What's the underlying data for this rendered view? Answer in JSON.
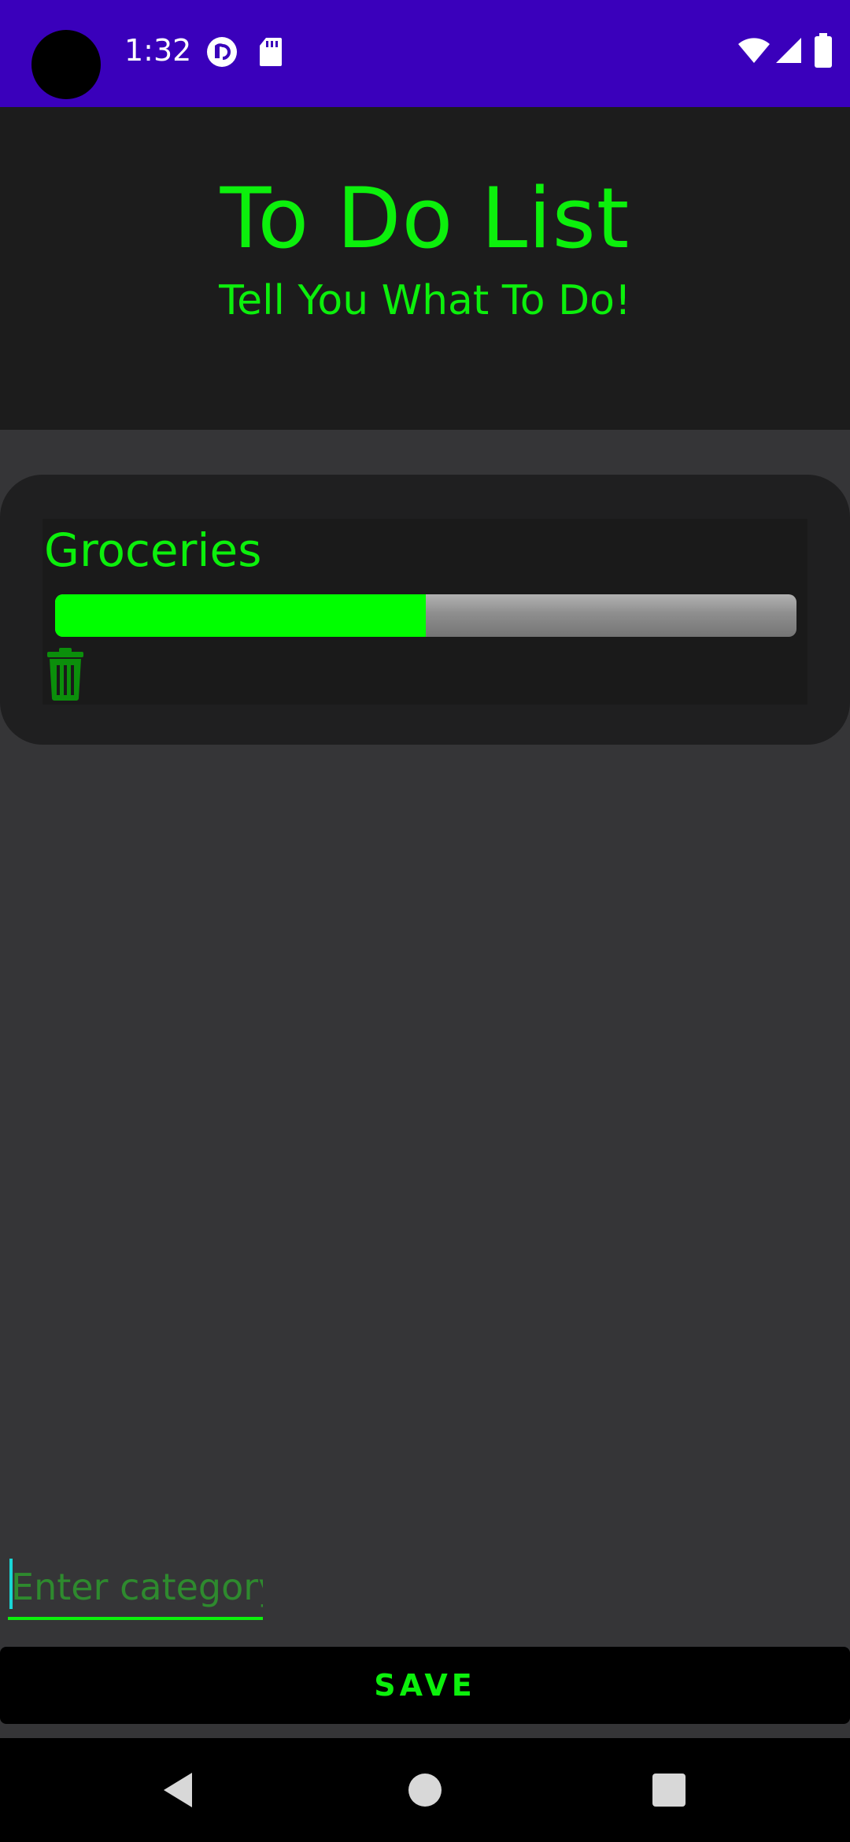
{
  "status_bar": {
    "time": "1:32",
    "icons": [
      "camera-cutout",
      "pocket-casts-icon",
      "sd-card-icon",
      "wifi-icon",
      "cellular-signal-icon",
      "battery-icon"
    ]
  },
  "header": {
    "title": "To Do List",
    "subtitle": "Tell You What To Do!"
  },
  "categories": [
    {
      "name": "Groceries",
      "progress_percent": 50,
      "delete_icon": "trash-icon"
    }
  ],
  "input": {
    "placeholder": "Enter category",
    "value": ""
  },
  "save_label": "SAVE",
  "nav_bar": {
    "icons": [
      "back-icon",
      "home-icon",
      "recents-icon"
    ]
  },
  "colors": {
    "status_bar": "#3a00bb",
    "accent_green": "#0cf00c",
    "progress_fill": "#00ff00",
    "background": "#353537"
  }
}
